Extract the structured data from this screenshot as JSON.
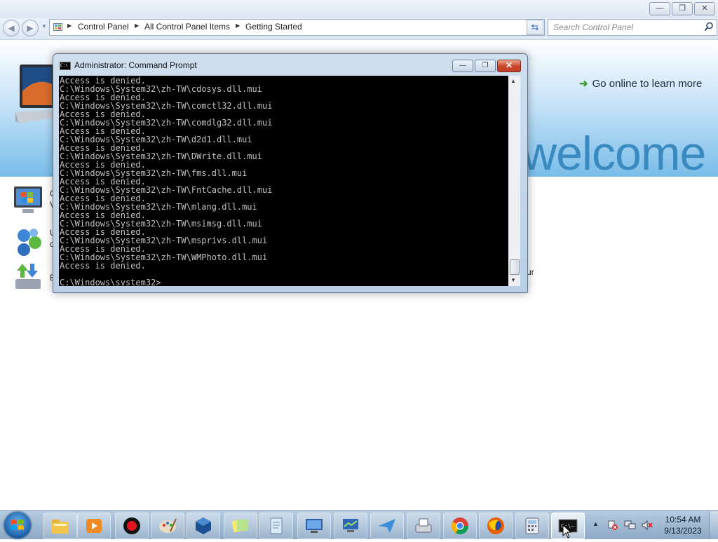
{
  "explorer": {
    "breadcrumb": [
      "Control Panel",
      "All Control Panel Items",
      "Getting Started"
    ],
    "search_placeholder": "Search Control Panel",
    "go_online": "Go online to learn more",
    "welcome": "welcome",
    "peek_letters": [
      "C",
      "V",
      "U",
      "c",
      "E",
      "ur"
    ]
  },
  "cmd": {
    "title": "Administrator:  Command Prompt",
    "lines": [
      "Access is denied.",
      "C:\\Windows\\System32\\zh-TW\\cdosys.dll.mui",
      "Access is denied.",
      "C:\\Windows\\System32\\zh-TW\\comctl32.dll.mui",
      "Access is denied.",
      "C:\\Windows\\System32\\zh-TW\\comdlg32.dll.mui",
      "Access is denied.",
      "C:\\Windows\\System32\\zh-TW\\d2d1.dll.mui",
      "Access is denied.",
      "C:\\Windows\\System32\\zh-TW\\DWrite.dll.mui",
      "Access is denied.",
      "C:\\Windows\\System32\\zh-TW\\fms.dll.mui",
      "Access is denied.",
      "C:\\Windows\\System32\\zh-TW\\FntCache.dll.mui",
      "Access is denied.",
      "C:\\Windows\\System32\\zh-TW\\mlang.dll.mui",
      "Access is denied.",
      "C:\\Windows\\System32\\zh-TW\\msimsg.dll.mui",
      "Access is denied.",
      "C:\\Windows\\System32\\zh-TW\\msprivs.dll.mui",
      "Access is denied.",
      "C:\\Windows\\System32\\zh-TW\\WMPhoto.dll.mui",
      "Access is denied.",
      "",
      "C:\\Windows\\system32>"
    ]
  },
  "taskbar": {
    "time": "10:54 AM",
    "date": "9/13/2023",
    "items": [
      {
        "icon": "file-explorer-icon",
        "state": "pinned"
      },
      {
        "icon": "media-player-icon",
        "state": "pinned"
      },
      {
        "icon": "record-icon",
        "state": "pinned"
      },
      {
        "icon": "paint-icon",
        "state": "pinned"
      },
      {
        "icon": "virtualbox-icon",
        "state": "pinned"
      },
      {
        "icon": "sticky-notes-icon",
        "state": "pinned"
      },
      {
        "icon": "notepad-icon",
        "state": "pinned"
      },
      {
        "icon": "remote-desktop-icon",
        "state": "pinned"
      },
      {
        "icon": "network-monitor-icon",
        "state": "pinned"
      },
      {
        "icon": "paper-plane-icon",
        "state": "pinned"
      },
      {
        "icon": "fax-icon",
        "state": "pinned"
      },
      {
        "icon": "chrome-icon",
        "state": "pinned"
      },
      {
        "icon": "firefox-icon",
        "state": "pinned"
      },
      {
        "icon": "calculator-icon",
        "state": "pinned"
      },
      {
        "icon": "command-prompt-icon",
        "state": "active"
      }
    ]
  },
  "colors": {
    "console_bg": "#000000",
    "console_text": "#c0c0c0",
    "banner_blue": "#79bde9",
    "welcome_text": "#3a89bf",
    "close_button": "#c7442a"
  }
}
